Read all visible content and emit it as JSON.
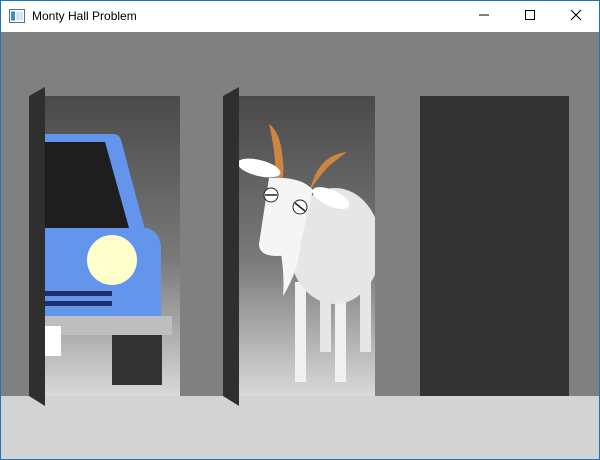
{
  "window": {
    "title": "Monty Hall Problem",
    "icons": {
      "app": "app-window-icon",
      "minimize": "minimize-icon",
      "maximize": "maximize-icon",
      "close": "close-icon"
    }
  },
  "scene": {
    "doors": [
      {
        "id": 1,
        "state": "open",
        "contents": "car"
      },
      {
        "id": 2,
        "state": "open",
        "contents": "goat"
      },
      {
        "id": 3,
        "state": "closed",
        "contents": ""
      }
    ],
    "colors": {
      "wall": "#808080",
      "floor": "#d3d3d3",
      "door_closed": "#333333",
      "door_panel": "#2f2f2f",
      "car_body": "#6495ed",
      "headlight": "#ffffcc",
      "goat": "#f0f0f0",
      "horn": "#cd853f"
    }
  }
}
